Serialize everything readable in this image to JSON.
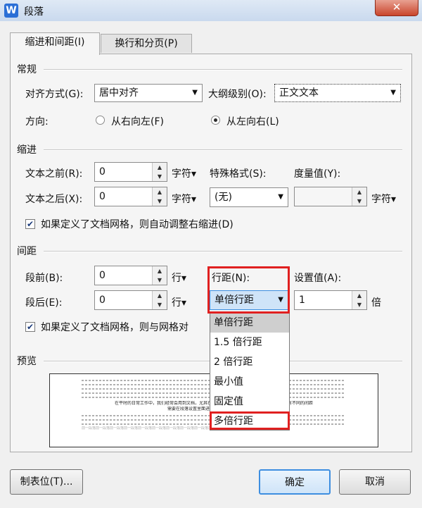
{
  "window": {
    "title": "段落",
    "app_icon": "W",
    "close_glyph": "✕"
  },
  "tabs": [
    {
      "label": "缩进和间距(I)",
      "active": true
    },
    {
      "label": "换行和分页(P)",
      "active": false
    }
  ],
  "general": {
    "section": "常规",
    "alignment_label": "对齐方式(G):",
    "alignment_value": "居中对齐",
    "outline_label": "大纲级别(O):",
    "outline_value": "正文文本",
    "direction_label": "方向:",
    "rtl_label": "从右向左(F)",
    "ltr_label": "从左向右(L)",
    "selected_direction": "ltr"
  },
  "indent": {
    "section": "缩进",
    "before_label": "文本之前(R):",
    "before_value": "0",
    "before_unit": "字符▾",
    "after_label": "文本之后(X):",
    "after_value": "0",
    "after_unit": "字符▾",
    "special_label": "特殊格式(S):",
    "special_value": "(无)",
    "measure_label": "度量值(Y):",
    "measure_value": "",
    "measure_unit": "字符▾",
    "grid_checkbox_label": "如果定义了文档网格，则自动调整右缩进(D)",
    "grid_checked": true
  },
  "spacing": {
    "section": "间距",
    "before_label": "段前(B):",
    "before_value": "0",
    "before_unit": "行▾",
    "after_label": "段后(E):",
    "after_value": "0",
    "after_unit": "行▾",
    "line_label": "行距(N):",
    "line_value": "单倍行距",
    "set_label": "设置值(A):",
    "set_value": "1",
    "set_unit": "倍",
    "grid_checkbox_label": "如果定义了文档网格，则与网格对",
    "grid_checked": true
  },
  "line_spacing_options": [
    "单倍行距",
    "1.5 倍行距",
    "2 倍行距",
    "最小值",
    "固定值",
    "多倍行距"
  ],
  "preview": {
    "section": "预览",
    "sample_line": "在平时的日常工作中，我们经常会用到文档，尤其在一些排版工作中，他们在不同的地方要求有不同的间距",
    "sample_line2": "需要在段落设置里面进行调整，一起来学习一下吧",
    "prev_para": "前一段落前一段落前一段落前一段落前一段落前一段落前一段落前一段落前一段落前一段落"
  },
  "buttons": {
    "tabs_label": "制表位(T)...",
    "ok_label": "确定",
    "cancel_label": "取消"
  },
  "colors": {
    "highlight": "#e02020",
    "default_button": "#3d8ee0"
  }
}
